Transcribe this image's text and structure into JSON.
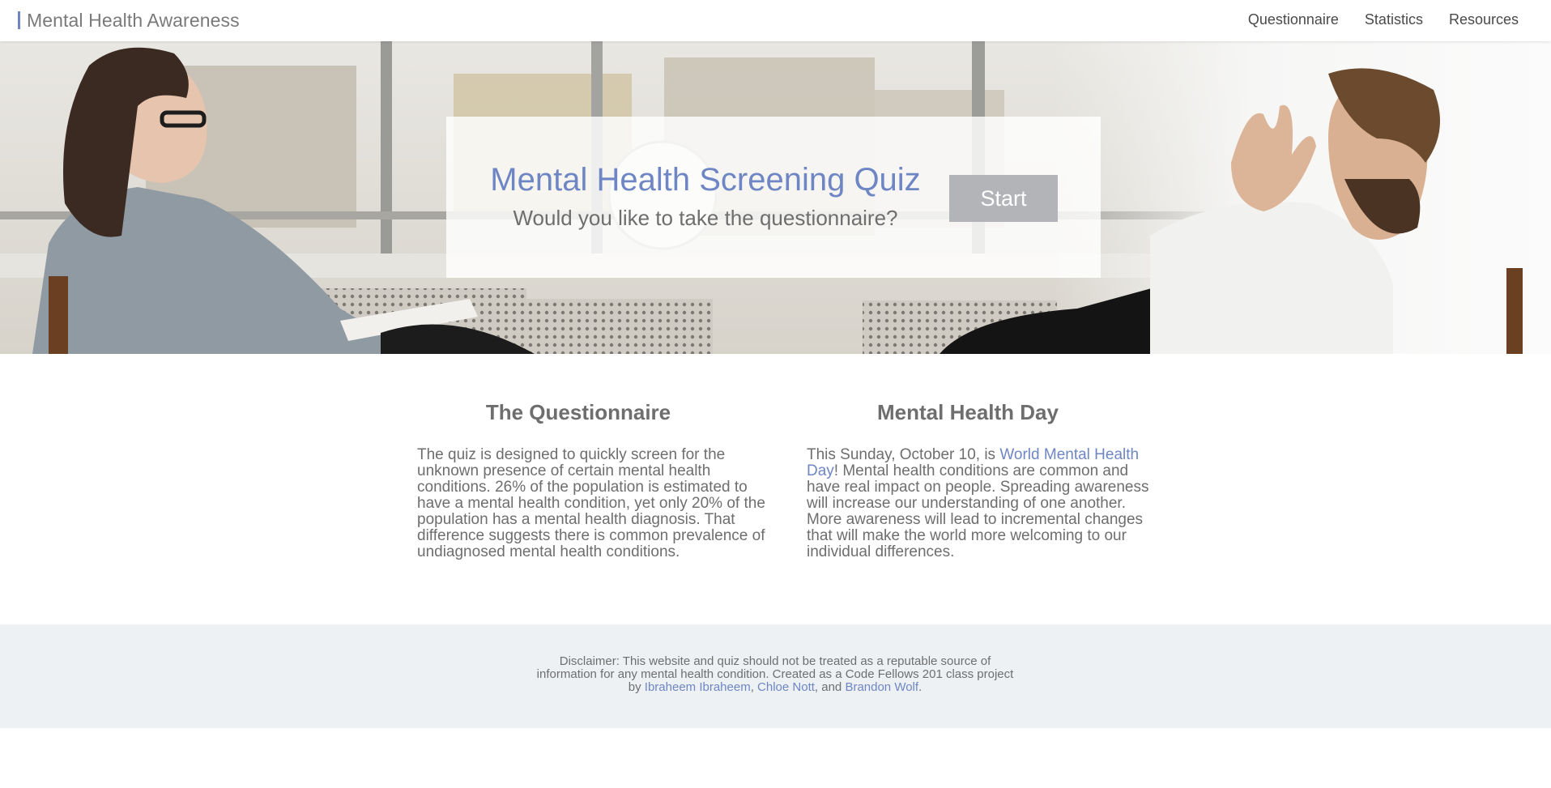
{
  "navbar": {
    "brand": "Mental Health Awareness",
    "links": [
      "Questionnaire",
      "Statistics",
      "Resources"
    ]
  },
  "hero": {
    "title": "Mental Health Screening Quiz",
    "subtitle": "Would you like to take the questionnaire?",
    "start_label": "Start"
  },
  "questionnaire": {
    "heading": "The Questionnaire",
    "body": "The quiz is designed to quickly screen for the unknown presence of certain mental health conditions. 26% of the population is estimated to have a mental health condition, yet only 20% of the population has a mental health diagnosis. That difference suggests there is common prevalence of undiagnosed mental health conditions."
  },
  "health_day": {
    "heading": "Mental Health Day",
    "body_before": "This Sunday, October 10, is ",
    "link": "World Mental Health Day",
    "body_after": "! Mental health conditions are common and have real impact on people. Spreading awareness will increase our understanding of one another. More awareness will lead to incremental changes that will make the world more welcoming to our individual differences."
  },
  "footer": {
    "disclaimer": "Disclaimer: This website and quiz should not be treated as a reputable source of information for any mental health condition. Created as a Code Fellows 201 class project by ",
    "author_1": "Ibraheem Ibraheem",
    "sep_1": ", ",
    "author_2": "Chloe Nott",
    "sep_2": ", and ",
    "author_3": "Brandon Wolf",
    "end": "."
  },
  "colors": {
    "accent": "#6e86c4",
    "text": "#6e6e6e",
    "button": "#b3b4b8",
    "footer_bg": "#eef1f4"
  },
  "icons": [
    "hero-photo-therapy-session"
  ]
}
